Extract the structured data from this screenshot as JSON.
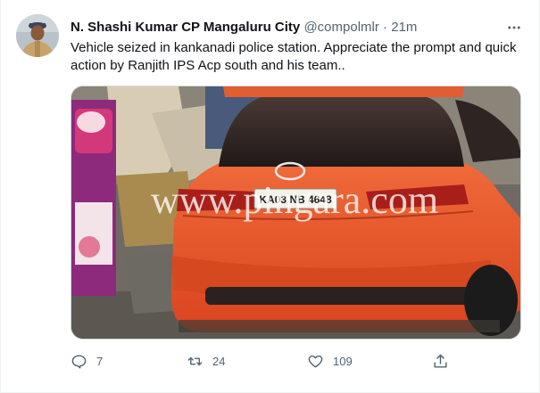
{
  "tweet": {
    "author_name": "N. Shashi Kumar CP Mangaluru City",
    "handle": "@compolmlr",
    "separator": "·",
    "time": "21m",
    "text": "Vehicle seized in kankanadi police station. Appreciate the prompt and quick action by Ranjith IPS Acp south and his team..",
    "image": {
      "watermark": "www.pingara.com",
      "license_plate": "KA03 NB 4648",
      "car_color": "#e5532a"
    }
  },
  "actions": {
    "reply_count": "7",
    "retweet_count": "24",
    "like_count": "109"
  },
  "icons": {
    "more": "more-dots-icon",
    "reply": "reply-icon",
    "retweet": "retweet-icon",
    "like": "heart-icon",
    "share": "share-icon"
  },
  "colors": {
    "text_primary": "#0f1419",
    "text_secondary": "#536471",
    "border": "#cfd9de"
  }
}
